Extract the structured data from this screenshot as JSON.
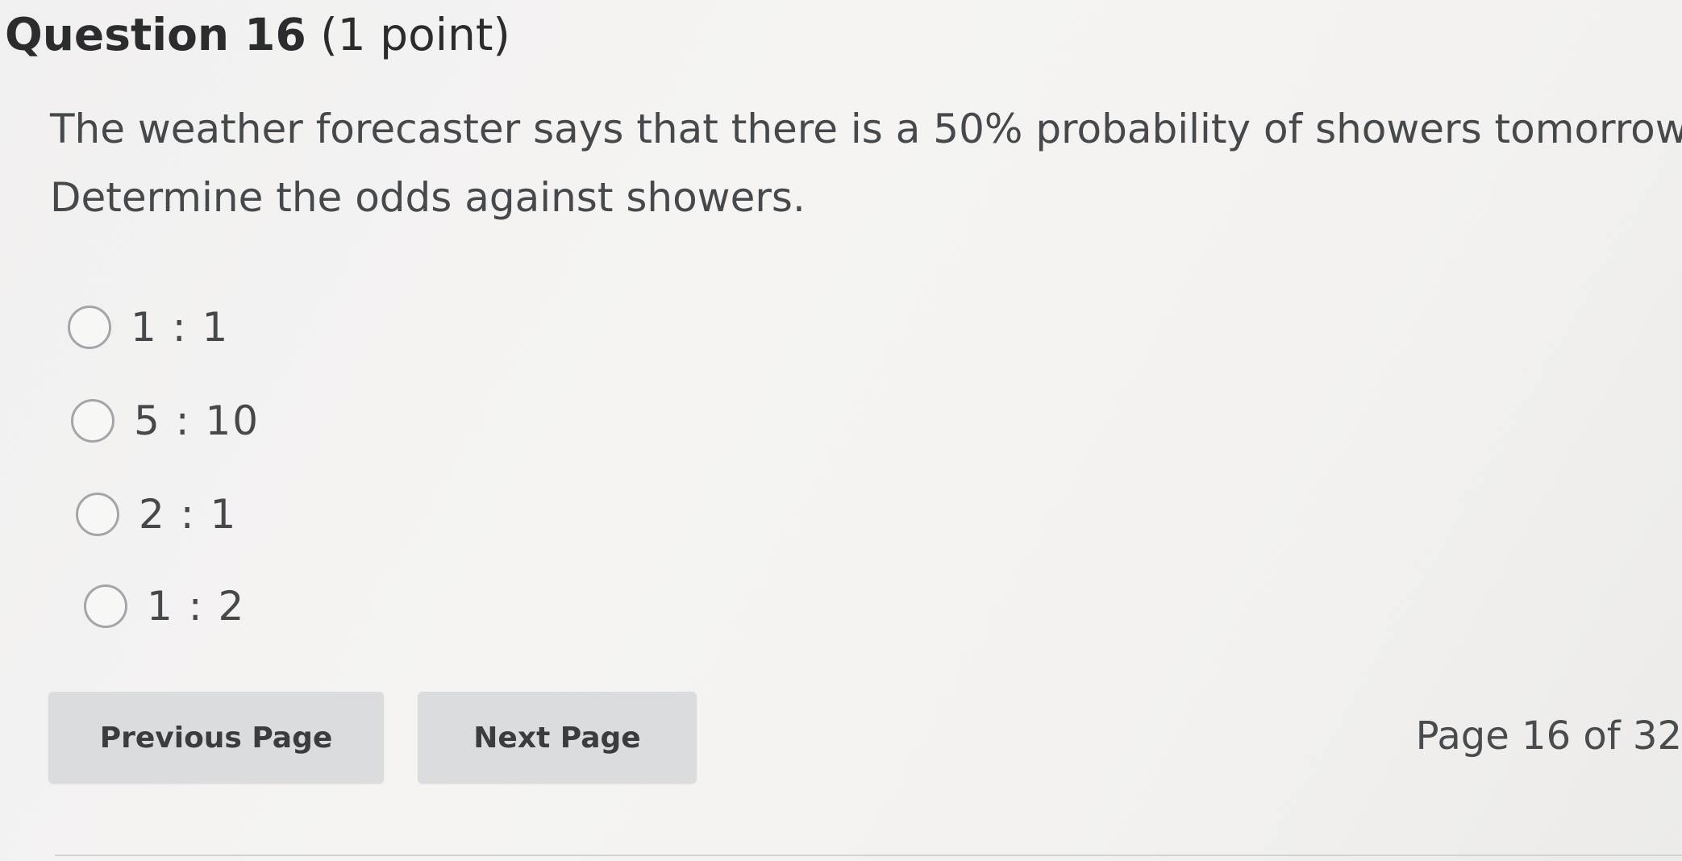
{
  "question": {
    "title": "Question 16",
    "points": "(1 point)",
    "text_line1": "The weather forecaster says that there is a 50% probability of showers tomorrow.",
    "text_line2": "Determine the odds against showers."
  },
  "options": [
    {
      "label": "1 : 1",
      "selected": false
    },
    {
      "label": "5 : 10",
      "selected": false
    },
    {
      "label": "2 : 1",
      "selected": false
    },
    {
      "label": "1 : 2",
      "selected": false
    }
  ],
  "navigation": {
    "previous_label": "Previous Page",
    "next_label": "Next Page",
    "page_indicator": "Page 16 of 32"
  },
  "colors": {
    "button_background": "#dadcdd",
    "radio_border": "#a3a6a9",
    "text": "#494c4e"
  }
}
